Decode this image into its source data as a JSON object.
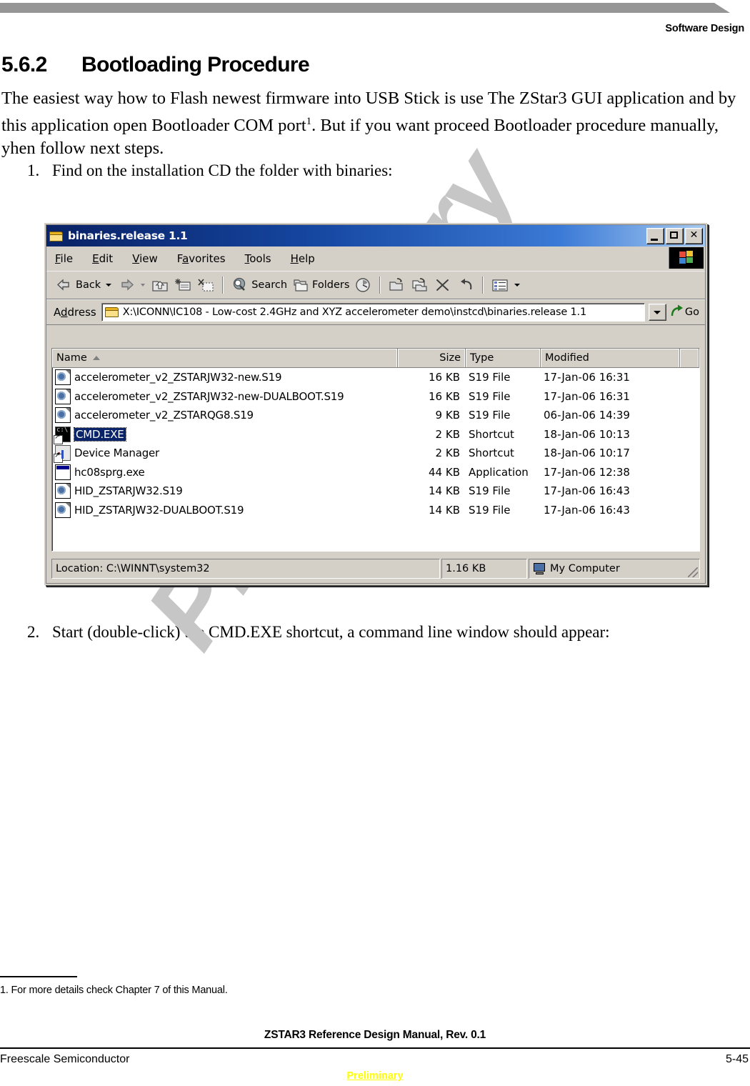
{
  "header": {
    "running_head": "Software Design"
  },
  "section": {
    "number": "5.6.2",
    "title": "Bootloading Procedure"
  },
  "body": {
    "paragraph_part1": "The easiest way how to Flash newest firmware into USB Stick is use The ZStar3 GUI application and by this application open Bootloader COM port",
    "footnote_marker": "1",
    "paragraph_part2": ". But if you want proceed Bootloader procedure manually, yhen follow next steps."
  },
  "steps": [
    {
      "number": "1.",
      "text": "Find on the installation CD the folder with binaries:"
    },
    {
      "number": "2.",
      "text": "Start (double-click) the CMD.EXE shortcut, a command line window should appear:"
    }
  ],
  "watermark": {
    "text": "Preliminary"
  },
  "explorer": {
    "title": "binaries.release 1.1",
    "window_buttons": {
      "minimize": "_",
      "maximize": "□",
      "close": "×"
    },
    "menus": [
      {
        "label": "File",
        "accel": "F",
        "rest": "ile"
      },
      {
        "label": "Edit",
        "accel": "E",
        "rest": "dit"
      },
      {
        "label": "View",
        "accel": "V",
        "rest": "iew"
      },
      {
        "label": "Favorites",
        "accel": "a",
        "pre": "F",
        "rest": "vorites"
      },
      {
        "label": "Tools",
        "accel": "T",
        "rest": "ools"
      },
      {
        "label": "Help",
        "accel": "H",
        "rest": "elp"
      }
    ],
    "toolbar": [
      {
        "name": "back",
        "label": "Back",
        "has_dropdown": true
      },
      {
        "name": "forward",
        "label": "",
        "has_dropdown": true
      },
      {
        "name": "up",
        "label": ""
      },
      {
        "name": "new-folder",
        "label": ""
      },
      {
        "name": "delete-selection",
        "label": ""
      },
      {
        "name": "search",
        "label": "Search"
      },
      {
        "name": "folders",
        "label": "Folders"
      },
      {
        "name": "history",
        "label": ""
      },
      {
        "name": "move-to",
        "label": ""
      },
      {
        "name": "copy-to",
        "label": ""
      },
      {
        "name": "delete",
        "label": ""
      },
      {
        "name": "undo",
        "label": ""
      },
      {
        "name": "views",
        "label": "",
        "has_dropdown": true
      }
    ],
    "address": {
      "label": "Address",
      "value": "X:\\ICONN\\IC108 - Low-cost 2.4GHz and XYZ accelerometer demo\\instcd\\binaries.release 1.1",
      "go_label": "Go"
    },
    "columns": {
      "name": "Name",
      "size": "Size",
      "type": "Type",
      "modified": "Modified"
    },
    "sort_column": "Name",
    "sort_direction": "ascending",
    "files": [
      {
        "name": "accelerometer_v2_ZSTARJW32-new.S19",
        "size": "16 KB",
        "type": "S19 File",
        "modified": "17-Jan-06 16:31",
        "icon": "s19-file-icon",
        "selected": false
      },
      {
        "name": "accelerometer_v2_ZSTARJW32-new-DUALBOOT.S19",
        "size": "16 KB",
        "type": "S19 File",
        "modified": "17-Jan-06 16:31",
        "icon": "s19-file-icon",
        "selected": false
      },
      {
        "name": "accelerometer_v2_ZSTARQG8.S19",
        "size": "9 KB",
        "type": "S19 File",
        "modified": "06-Jan-06 14:39",
        "icon": "s19-file-icon",
        "selected": false
      },
      {
        "name": "CMD.EXE",
        "size": "2 KB",
        "type": "Shortcut",
        "modified": "18-Jan-06 10:13",
        "icon": "cmd-shortcut-icon",
        "selected": true
      },
      {
        "name": "Device Manager",
        "size": "2 KB",
        "type": "Shortcut",
        "modified": "18-Jan-06 10:17",
        "icon": "device-manager-shortcut-icon",
        "selected": false
      },
      {
        "name": "hc08sprg.exe",
        "size": "44 KB",
        "type": "Application",
        "modified": "17-Jan-06 12:38",
        "icon": "application-icon",
        "selected": false
      },
      {
        "name": "HID_ZSTARJW32.S19",
        "size": "14 KB",
        "type": "S19 File",
        "modified": "17-Jan-06 16:43",
        "icon": "s19-file-icon",
        "selected": false
      },
      {
        "name": "HID_ZSTARJW32-DUALBOOT.S19",
        "size": "14 KB",
        "type": "S19 File",
        "modified": "17-Jan-06 16:43",
        "icon": "s19-file-icon",
        "selected": false
      }
    ],
    "status": {
      "location": "Location: C:\\WINNT\\system32",
      "size": "1.16 KB",
      "zone": "My Computer"
    }
  },
  "footnote": {
    "text": "1. For more details check Chapter 7 of this Manual."
  },
  "footer": {
    "manual_title": "ZSTAR3 Reference Design Manual, Rev. 0.1",
    "company": "Freescale Semiconductor",
    "page": "5-45",
    "preliminary": "Preliminary"
  },
  "colors": {
    "header_bar": "#969696",
    "titlebar_start": "#0a246a",
    "titlebar_end": "#a6caf0",
    "window_face": "#d4d0c8",
    "selection": "#0a246a",
    "watermark": "#c6c6c6",
    "preliminary_yellow": "#ffff00"
  }
}
